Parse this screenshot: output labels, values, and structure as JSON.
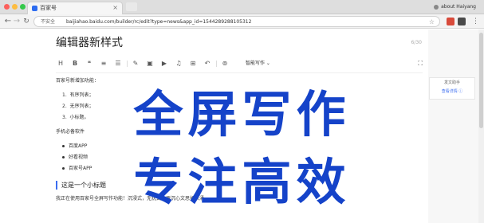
{
  "browser": {
    "tab_title": "百家号",
    "tab_close": "×",
    "profile_label": "about Haiyang",
    "security_label": "不安全",
    "url": "baijiahao.baidu.com/builder/rc/edit?type=news&app_id=1544289288105312",
    "icons": {
      "back": "back-icon",
      "forward": "forward-icon",
      "reload": "reload-icon",
      "star": "star-icon",
      "menu": "menu-icon"
    }
  },
  "editor": {
    "title": "编辑器新样式",
    "word_count": "6/30",
    "format_buttons": [
      "H",
      "B",
      "❝",
      "≡",
      "☰",
      "✎",
      "▣",
      "▶",
      "♫",
      "⊞",
      "↶",
      "⊚"
    ],
    "smart_write": "智能写作 ⌄",
    "content": {
      "intro": "百家号新增加功能：",
      "ordered": [
        "有序列表；",
        "无序列表；",
        "小标题。"
      ],
      "software_heading": "手机必备软件",
      "unordered": [
        "百度APP",
        "好看视频",
        "百家号APP"
      ],
      "subheading": "这是一个小标题",
      "closing": "我正在使用百家号全屏写作功能！沉浸式，无扰式，更沉心文思如泉涌"
    }
  },
  "side_panel": {
    "title": "发文助手",
    "link": "查看详情 ⓘ"
  },
  "overlay": {
    "line1": "全屏写作",
    "line2": "专注高效",
    "color": "#1543c9"
  }
}
